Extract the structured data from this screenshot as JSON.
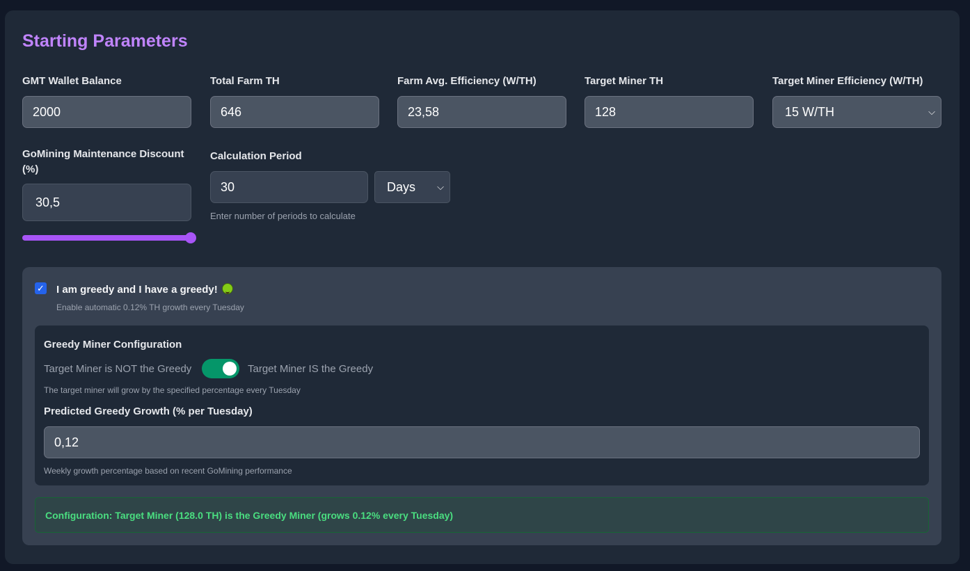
{
  "section_title": "Starting Parameters",
  "fields": {
    "wallet_balance": {
      "label": "GMT Wallet Balance",
      "value": "2000"
    },
    "total_farm_th": {
      "label": "Total Farm TH",
      "value": "646"
    },
    "farm_efficiency": {
      "label": "Farm Avg. Efficiency (W/TH)",
      "value": "23,58"
    },
    "target_miner_th": {
      "label": "Target Miner TH",
      "value": "128"
    },
    "target_efficiency": {
      "label": "Target Miner Efficiency (W/TH)",
      "value": "15 W/TH"
    },
    "maintenance_discount": {
      "label_line1": "GoMining Maintenance Discount",
      "label_line2": "(%)",
      "value": "30,5",
      "slider_fraction": 1.0
    },
    "calculation_period": {
      "label": "Calculation Period",
      "value": "30",
      "unit": "Days",
      "hint": "Enter number of periods to calculate"
    }
  },
  "greedy": {
    "checked": true,
    "label": "I am greedy and I have a greedy!",
    "hint": "Enable automatic 0.12% TH growth every Tuesday",
    "config_title": "Greedy Miner Configuration",
    "toggle_off_label": "Target Miner is NOT the Greedy",
    "toggle_on_label": "Target Miner IS the Greedy",
    "toggle_on": true,
    "toggle_hint": "The target miner will grow by the specified percentage every Tuesday",
    "growth_label": "Predicted Greedy Growth (% per Tuesday)",
    "growth_value": "0,12",
    "growth_hint": "Weekly growth percentage based on recent GoMining performance",
    "banner": "Configuration: Target Miner (128.0 TH) is the Greedy Miner (grows 0.12% every Tuesday)"
  },
  "colors": {
    "accent": "#c084fc",
    "slider": "#a855f7",
    "toggle": "#059669",
    "banner_text": "#4ade80"
  }
}
